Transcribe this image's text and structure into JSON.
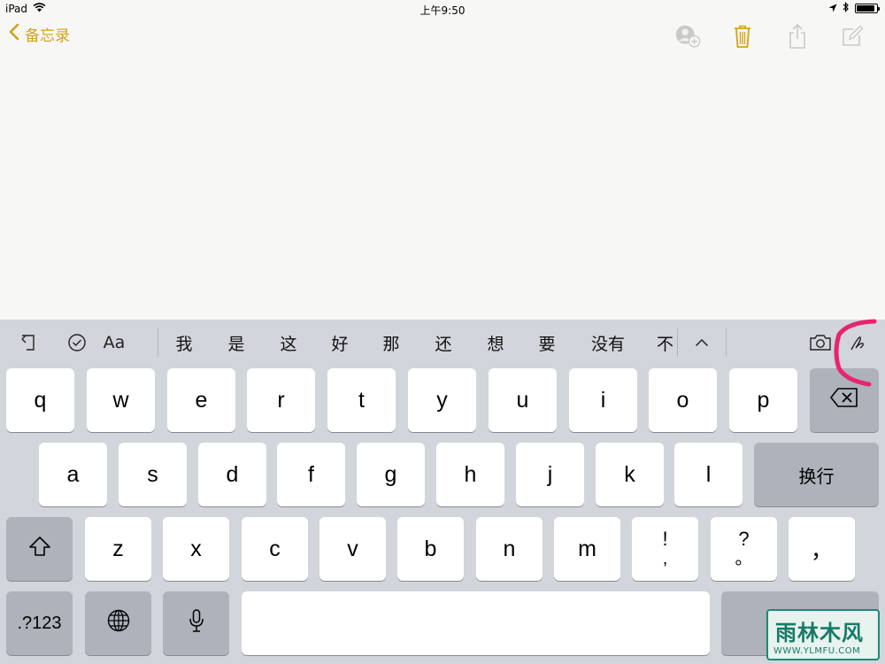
{
  "status_bar": {
    "device": "iPad",
    "time": "上午9:50"
  },
  "nav": {
    "back_label": "备忘录",
    "accent_color": "#d5a216",
    "icons": [
      "add-person-icon",
      "trash-icon",
      "share-icon",
      "compose-icon"
    ]
  },
  "toolbar": {
    "icons_left": [
      "undo-icon",
      "checklist-icon"
    ],
    "format_label": "Aa",
    "candidates": [
      "我",
      "是",
      "这",
      "好",
      "那",
      "还",
      "想",
      "要",
      "没有",
      "不"
    ],
    "icons_right": [
      "expand-up-icon",
      "camera-icon",
      "sketch-icon"
    ]
  },
  "keyboard": {
    "row1": [
      "q",
      "w",
      "e",
      "r",
      "t",
      "y",
      "u",
      "i",
      "o",
      "p"
    ],
    "row2": [
      "a",
      "s",
      "d",
      "f",
      "g",
      "h",
      "j",
      "k",
      "l"
    ],
    "return_label": "换行",
    "row3": [
      "z",
      "x",
      "c",
      "v",
      "b",
      "n",
      "m"
    ],
    "punct1_top": "!",
    "punct1_bottom": ",",
    "punct2_top": "?",
    "punct2_bottom": "。",
    "punct3": "，",
    "numbers_label": ".?123"
  },
  "watermark": {
    "brand_text": "雨林木风",
    "brand_url": "WWW.YLMFU.COM",
    "color": "#1b8a76"
  },
  "annotation_color": "#e8246e"
}
